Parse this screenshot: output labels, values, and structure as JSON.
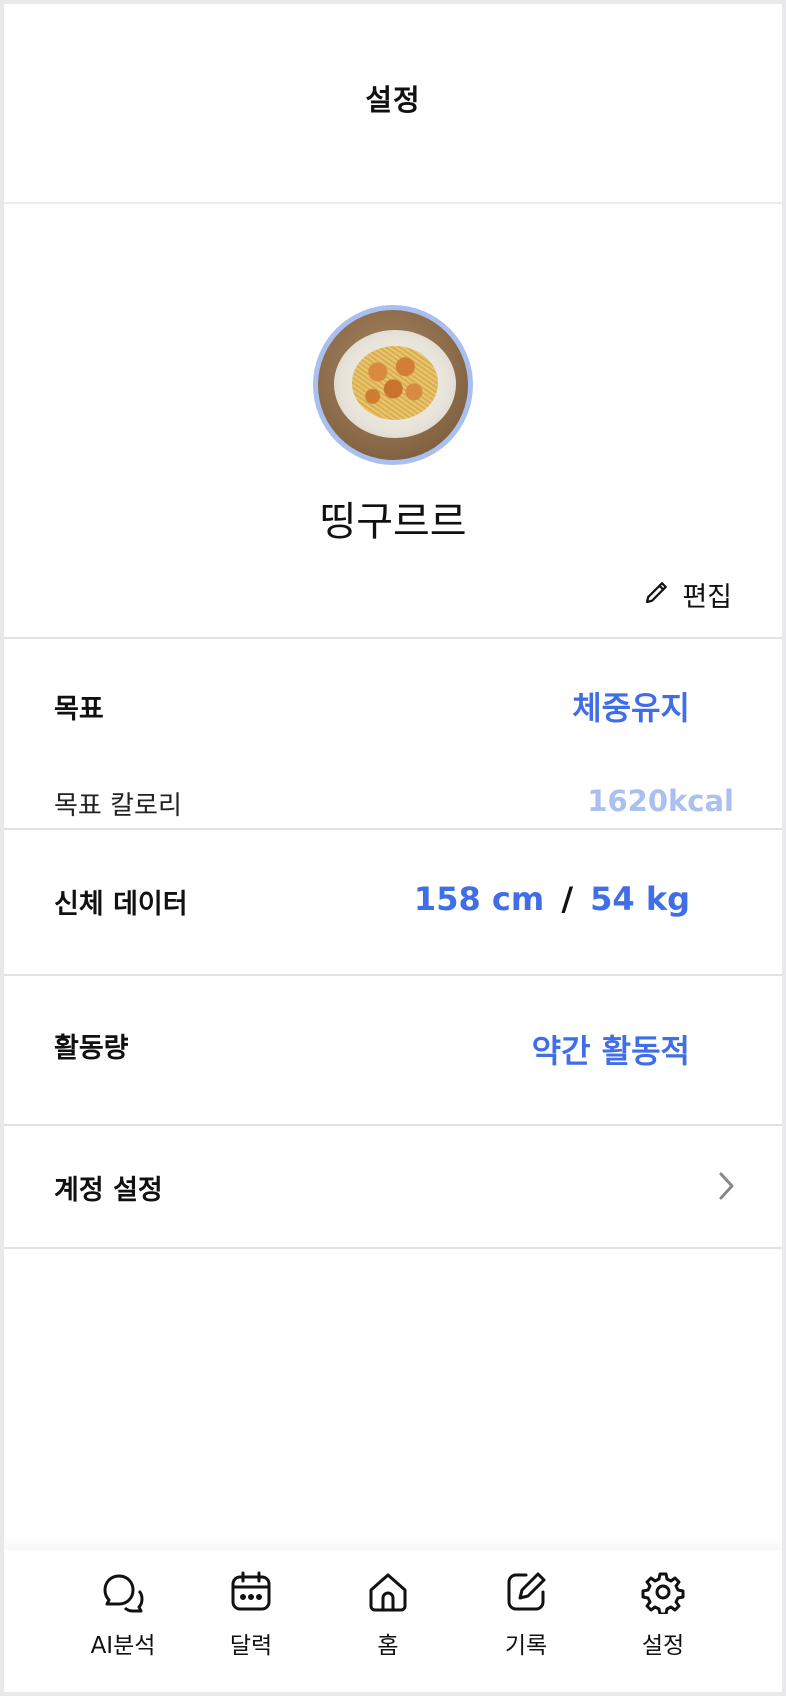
{
  "header": {
    "title": "설정"
  },
  "profile": {
    "name": "띵구르르",
    "edit_label": "편집"
  },
  "goal": {
    "label": "목표",
    "value": "체중유지",
    "calorie_label": "목표 칼로리",
    "calorie_value": "1620kcal"
  },
  "body": {
    "label": "신체 데이터",
    "height": "158 cm",
    "separator": "/",
    "weight": "54 kg"
  },
  "activity": {
    "label": "활동량",
    "value": "약간 활동적"
  },
  "account": {
    "label": "계정 설정"
  },
  "nav": {
    "items": [
      {
        "label": "AI분석",
        "icon": "chat-bubbles-icon"
      },
      {
        "label": "달력",
        "icon": "calendar-icon"
      },
      {
        "label": "홈",
        "icon": "home-icon"
      },
      {
        "label": "기록",
        "icon": "edit-note-icon"
      },
      {
        "label": "설정",
        "icon": "gear-icon"
      }
    ]
  },
  "colors": {
    "accent": "#3f6ee6",
    "accent_light": "#a9c0f0",
    "avatar_ring": "#a9bff0"
  }
}
